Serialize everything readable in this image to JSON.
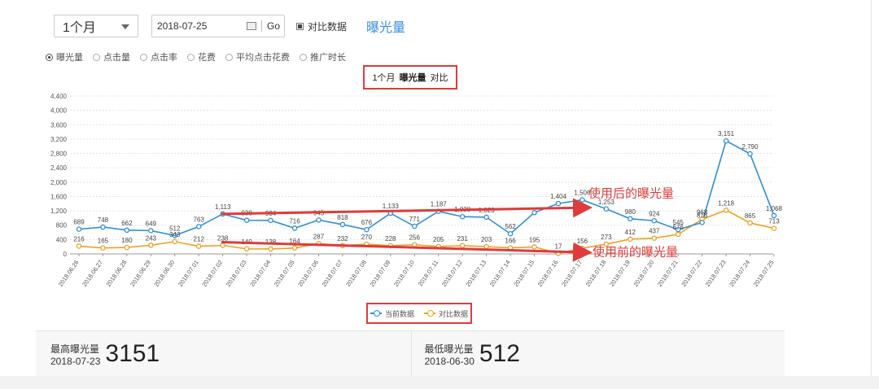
{
  "toolbar": {
    "period": "1个月",
    "date": "2018-07-25",
    "go_label": "Go",
    "compare_label": "对比数据",
    "metric_title": "曝光量"
  },
  "metrics": [
    {
      "label": "曝光量",
      "selected": true
    },
    {
      "label": "点击量",
      "selected": false
    },
    {
      "label": "点击率",
      "selected": false
    },
    {
      "label": "花费",
      "selected": false
    },
    {
      "label": "平均点击花费",
      "selected": false
    },
    {
      "label": "推广时长",
      "selected": false
    }
  ],
  "chart_title": {
    "period": "1个月",
    "metric": "曝光量",
    "suffix": "对比"
  },
  "annotations": {
    "after": "使用后的曝光量",
    "before": "使用前的曝光量"
  },
  "colors": {
    "current": "#2e8fd4",
    "compare": "#f0a11f",
    "highlight": "#e03a3a"
  },
  "chart_data": {
    "type": "line",
    "x": [
      "2018.06.26",
      "2018.06.27",
      "2018.06.28",
      "2018.06.29",
      "2018.06.30",
      "2018.07.01",
      "2018.07.02",
      "2018.07.03",
      "2018.07.04",
      "2018.07.05",
      "2018.07.06",
      "2018.07.07",
      "2018.07.08",
      "2018.07.09",
      "2018.07.10",
      "2018.07.11",
      "2018.07.12",
      "2018.07.13",
      "2018.07.14",
      "2018.07.15",
      "2018.07.16",
      "2018.07.17",
      "2018.07.18",
      "2018.07.19",
      "2018.07.20",
      "2018.07.21",
      "2018.07.22",
      "2018.07.23",
      "2018.07.24",
      "2018.07.25"
    ],
    "y_ticks": [
      "0",
      "400",
      "800",
      "1,200",
      "1,600",
      "2,000",
      "2,400",
      "2,800",
      "3,200",
      "3,600",
      "4,000",
      "4,400"
    ],
    "ylim": [
      0,
      4400
    ],
    "grid": true,
    "series": [
      {
        "name": "当前数据",
        "values": [
          689,
          748,
          662,
          649,
          512,
          763,
          1113,
          938,
          934,
          716,
          945,
          818,
          676,
          1133,
          771,
          1187,
          1038,
          1023,
          562,
          1150,
          1404,
          1506,
          1253,
          980,
          924,
          676,
          876,
          3151,
          2790,
          1068
        ],
        "labels": [
          "689",
          "748",
          "662",
          "649",
          "512",
          "763",
          "1,113",
          "938",
          "934",
          "716",
          "945",
          "818",
          "676",
          "1,133",
          "771",
          "1,187",
          "1,038",
          "1,023",
          "562",
          "",
          "1,404",
          "1,506",
          "1,253",
          "980",
          "924",
          "545",
          "876",
          "3,151",
          "2,790",
          "1,068"
        ]
      },
      {
        "name": "对比数据",
        "values": [
          216,
          165,
          180,
          243,
          343,
          212,
          238,
          140,
          138,
          164,
          287,
          232,
          270,
          228,
          256,
          205,
          231,
          203,
          168,
          195,
          17,
          156,
          273,
          412,
          437,
          545,
          968,
          1218,
          865,
          713
        ],
        "labels": [
          "216",
          "165",
          "180",
          "243",
          "343",
          "212",
          "238",
          "140",
          "138",
          "164",
          "287",
          "232",
          "270",
          "228",
          "256",
          "205",
          "231",
          "203",
          "166",
          "195",
          "17",
          "156",
          "273",
          "412",
          "437",
          "676",
          "968",
          "1,218",
          "865",
          "713"
        ]
      }
    ]
  },
  "stats": [
    {
      "title": "最高曝光量",
      "date": "2018-07-23",
      "value": "3151"
    },
    {
      "title": "最低曝光量",
      "date": "2018-06-30",
      "value": "512"
    }
  ]
}
